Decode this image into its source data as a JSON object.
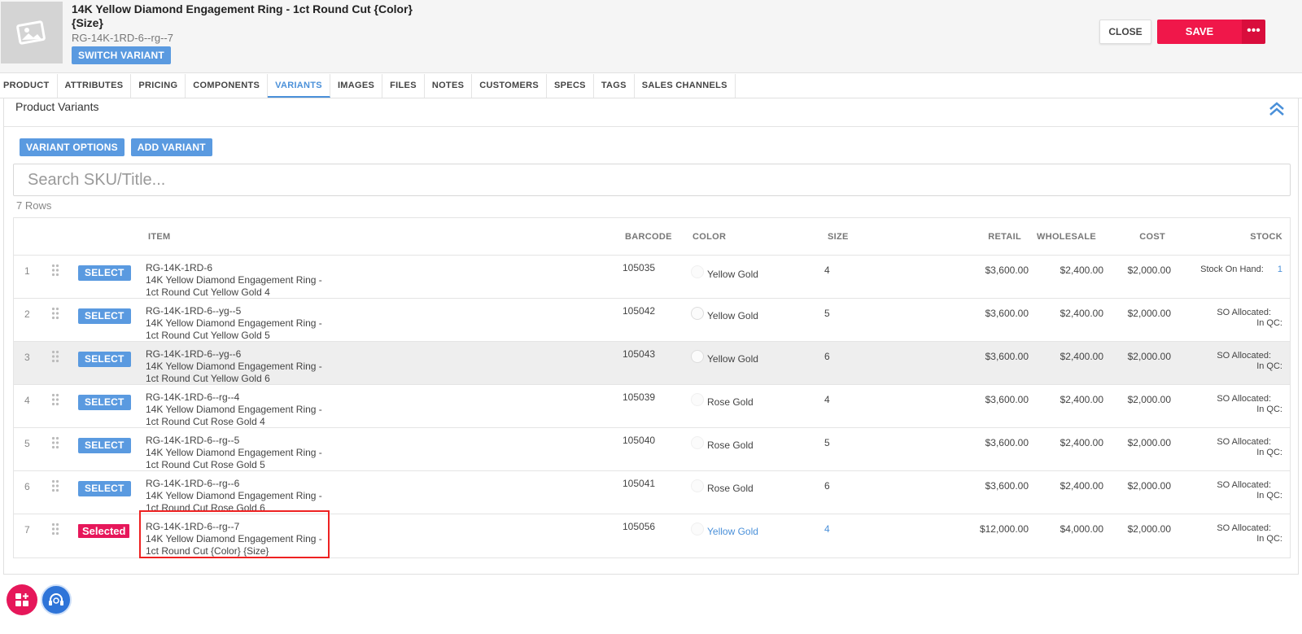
{
  "header": {
    "title": "14K Yellow Diamond Engagement Ring - 1ct Round Cut {Color} {Size}",
    "sku": "RG-14K-1RD-6--rg--7",
    "switch_variant": "SWITCH VARIANT",
    "close": "CLOSE",
    "save": "SAVE",
    "more": "•••"
  },
  "tabs": [
    "PRODUCT",
    "ATTRIBUTES",
    "PRICING",
    "COMPONENTS",
    "VARIANTS",
    "IMAGES",
    "FILES",
    "NOTES",
    "CUSTOMERS",
    "SPECS",
    "TAGS",
    "SALES CHANNELS"
  ],
  "active_tab": "VARIANTS",
  "panel": {
    "title": "Product Variants",
    "variant_options": "VARIANT OPTIONS",
    "add_variant": "ADD VARIANT",
    "search_placeholder": "Search SKU/Title...",
    "rows_count": "7 Rows"
  },
  "table": {
    "columns": {
      "item": "ITEM",
      "barcode": "BARCODE",
      "color": "COLOR",
      "size": "SIZE",
      "retail": "RETAIL",
      "wholesale": "WHOLESALE",
      "cost": "COST",
      "stock": "STOCK"
    },
    "select_label": "SELECT",
    "selected_label": "Selected",
    "rows": [
      {
        "num": "1",
        "sku": "RG-14K-1RD-6",
        "title1": "14K Yellow Diamond Engagement Ring -",
        "title2": "1ct Round Cut Yellow Gold 4",
        "barcode": "105035",
        "color": "Yellow Gold",
        "size": "4",
        "retail": "$3,600.00",
        "wholesale": "$2,400.00",
        "cost": "$2,000.00",
        "stock1": "Stock On Hand:",
        "stock_val": "1",
        "stock2": ""
      },
      {
        "num": "2",
        "sku": "RG-14K-1RD-6--yg--5",
        "title1": "14K Yellow Diamond Engagement Ring -",
        "title2": "1ct Round Cut Yellow Gold 5",
        "barcode": "105042",
        "color": "Yellow Gold",
        "size": "5",
        "retail": "$3,600.00",
        "wholesale": "$2,400.00",
        "cost": "$2,000.00",
        "stock1": "SO Allocated:",
        "stock_val": "",
        "stock2": "In QC:"
      },
      {
        "num": "3",
        "sku": "RG-14K-1RD-6--yg--6",
        "title1": "14K Yellow Diamond Engagement Ring -",
        "title2": "1ct Round Cut Yellow Gold 6",
        "barcode": "105043",
        "color": "Yellow Gold",
        "size": "6",
        "retail": "$3,600.00",
        "wholesale": "$2,400.00",
        "cost": "$2,000.00",
        "stock1": "SO Allocated:",
        "stock_val": "",
        "stock2": "In QC:"
      },
      {
        "num": "4",
        "sku": "RG-14K-1RD-6--rg--4",
        "title1": "14K Yellow Diamond Engagement Ring -",
        "title2": "1ct Round Cut Rose Gold 4",
        "barcode": "105039",
        "color": "Rose Gold",
        "size": "4",
        "retail": "$3,600.00",
        "wholesale": "$2,400.00",
        "cost": "$2,000.00",
        "stock1": "SO Allocated:",
        "stock_val": "",
        "stock2": "In QC:"
      },
      {
        "num": "5",
        "sku": "RG-14K-1RD-6--rg--5",
        "title1": "14K Yellow Diamond Engagement Ring -",
        "title2": "1ct Round Cut Rose Gold 5",
        "barcode": "105040",
        "color": "Rose Gold",
        "size": "5",
        "retail": "$3,600.00",
        "wholesale": "$2,400.00",
        "cost": "$2,000.00",
        "stock1": "SO Allocated:",
        "stock_val": "",
        "stock2": "In QC:"
      },
      {
        "num": "6",
        "sku": "RG-14K-1RD-6--rg--6",
        "title1": "14K Yellow Diamond Engagement Ring -",
        "title2": "1ct Round Cut Rose Gold 6",
        "barcode": "105041",
        "color": "Rose Gold",
        "size": "6",
        "retail": "$3,600.00",
        "wholesale": "$2,400.00",
        "cost": "$2,000.00",
        "stock1": "SO Allocated:",
        "stock_val": "",
        "stock2": "In QC:"
      },
      {
        "num": "7",
        "sku": "RG-14K-1RD-6--rg--7",
        "title1": "14K Yellow Diamond Engagement Ring -",
        "title2": "1ct Round Cut {Color} {Size}",
        "barcode": "105056",
        "color": "Yellow Gold",
        "size": "4",
        "retail": "$12,000.00",
        "wholesale": "$4,000.00",
        "cost": "$2,000.00",
        "stock1": "SO Allocated:",
        "stock_val": "",
        "stock2": "In QC:"
      }
    ]
  },
  "colors": {
    "accent_blue": "#5a9ae0",
    "save_red": "#f0174a",
    "selected_pink": "#e6175a",
    "link_blue": "#4a90d9"
  },
  "icons": [
    "image-placeholder-icon",
    "chevron-double-up-icon",
    "drag-handle-icon",
    "grid-plus-icon",
    "support-headset-icon"
  ]
}
